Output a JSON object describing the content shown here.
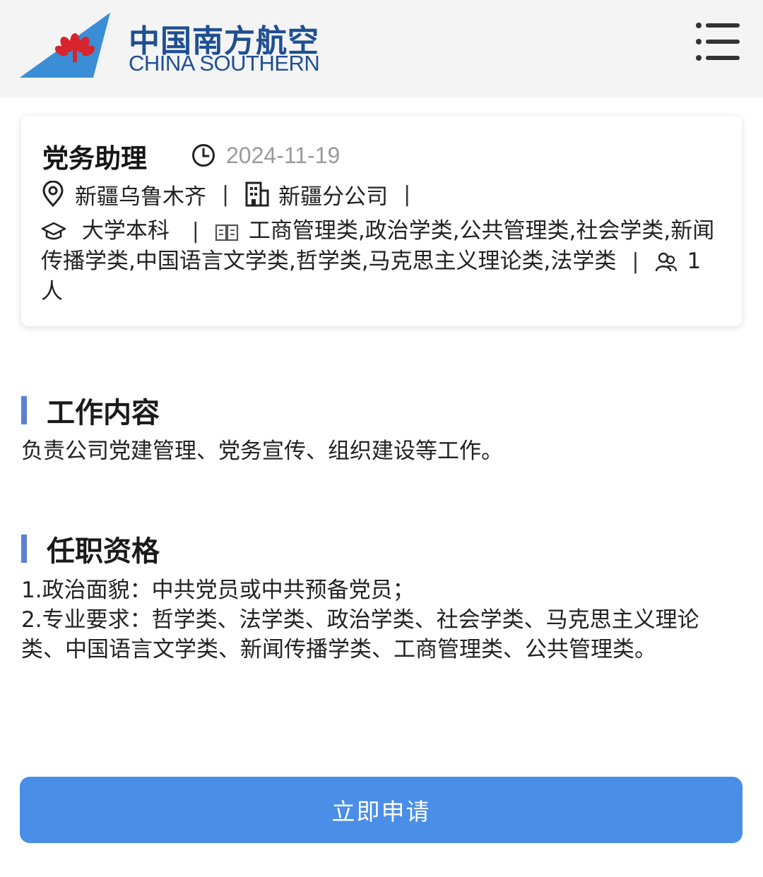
{
  "header": {
    "brand_cn": "中国南方航空",
    "brand_en": "CHINA SOUTHERN",
    "logo_icon": "kapok-flower-tail-logo",
    "menu_icon": "menu-list-icon",
    "brand_color": "#1f4f93"
  },
  "job": {
    "title": "党务助理",
    "date": "2024-11-19",
    "location": "新疆乌鲁木齐",
    "company": "新疆分公司",
    "education": "大学本科",
    "majors": "工商管理类,政治学类,公共管理类,社会学类,新闻传播学类,中国语言文学类,哲学类,马克思主义理论类,法学类",
    "headcount": "1人",
    "separator": "|"
  },
  "sections": {
    "duty_title": "工作内容",
    "duty_text": "负责公司党建管理、党务宣传、组织建设等工作。",
    "qual_title": "任职资格",
    "qual_line1": "1.政治面貌：中共党员或中共预备党员；",
    "qual_line2": "2.专业要求：哲学类、法学类、政治学类、社会学类、马克思主义理论类、中国语言文学类、新闻传播学类、工商管理类、公共管理类。"
  },
  "apply_button": "立即申请",
  "colors": {
    "accent_bar": "#5b80d6",
    "button": "#4a8ee8",
    "muted": "#9a9a9a"
  }
}
